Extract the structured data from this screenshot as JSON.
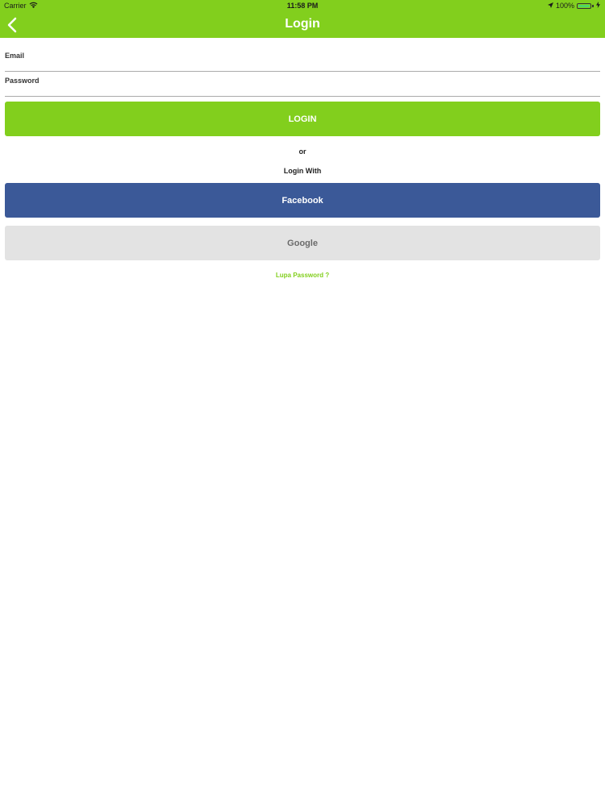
{
  "status_bar": {
    "carrier": "Carrier",
    "time": "11:58 PM",
    "battery": "100%",
    "wifi_icon": "wifi-icon",
    "location_icon": "location-arrow-icon",
    "charging_icon": "charging-bolt-icon"
  },
  "navbar": {
    "title": "Login",
    "back_icon": "chevron-left-icon",
    "background_color": "#82cf1d"
  },
  "form": {
    "email_label": "Email",
    "email_value": "",
    "password_label": "Password",
    "password_value": ""
  },
  "buttons": {
    "login_label": "LOGIN",
    "facebook_label": "Facebook",
    "google_label": "Google"
  },
  "divider_text": "or",
  "login_with_text": "Login With",
  "forgot_password_text": "Lupa Password ?",
  "colors": {
    "accent": "#82cf1d",
    "facebook": "#3b5998",
    "google_bg": "#e3e3e3"
  }
}
